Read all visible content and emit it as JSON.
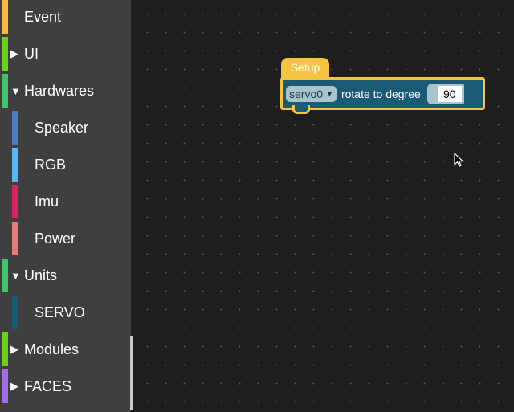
{
  "sidebar": {
    "items": [
      {
        "label": "Event",
        "color": "#f5b942",
        "type": "category",
        "expanded": null
      },
      {
        "label": "UI",
        "color": "#6cd21e",
        "type": "category",
        "expanded": false
      },
      {
        "label": "Hardwares",
        "color": "#3fc46a",
        "type": "category",
        "expanded": true
      },
      {
        "label": "Speaker",
        "color": "#4a7dc0",
        "type": "sub"
      },
      {
        "label": "RGB",
        "color": "#5bb4f5",
        "type": "sub"
      },
      {
        "label": "Imu",
        "color": "#d8245a",
        "type": "sub"
      },
      {
        "label": "Power",
        "color": "#e87a7a",
        "type": "sub"
      },
      {
        "label": "Units",
        "color": "#3fc46a",
        "type": "category",
        "expanded": true
      },
      {
        "label": "SERVO",
        "color": "#1a5a75",
        "type": "sub"
      },
      {
        "label": "Modules",
        "color": "#6cd21e",
        "type": "category",
        "expanded": false
      },
      {
        "label": "FACES",
        "color": "#a06ee8",
        "type": "category",
        "expanded": false
      }
    ]
  },
  "workspace": {
    "setup_label": "Setup",
    "block": {
      "servo": "servo0",
      "text": "rotate to degree",
      "value": "90",
      "color": "#1a5a75",
      "accent": "#f5c542"
    }
  }
}
